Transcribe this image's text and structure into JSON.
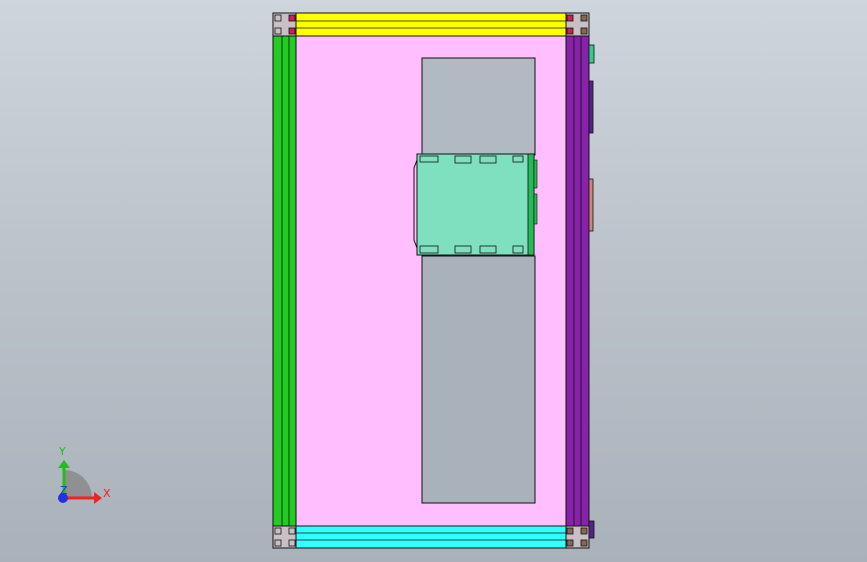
{
  "viewport": {
    "background_top": "#cfd5dc",
    "background_bottom": "#a9b1ba"
  },
  "model": {
    "colors": {
      "top_rail": "#ffff00",
      "bottom_rail": "#33ffff",
      "left_post": "#22cc22",
      "right_post": "#8822aa",
      "back_panel": "#ffbfff",
      "cutout": "#a9b1ba",
      "module": "#7fe0bf",
      "module_side": "#22bb55",
      "corner_marker": "#cc2255",
      "side_tab_green": "#33cc88",
      "side_tab_dark": "#552288",
      "side_tab_salmon": "#cc8877",
      "edge": "#111111"
    }
  },
  "triad": {
    "x_label": "X",
    "y_label": "Y",
    "z_label": "Z",
    "x_color": "#ee2222",
    "y_color": "#22bb22",
    "z_color": "#2233dd",
    "arc_color": "#777777"
  }
}
